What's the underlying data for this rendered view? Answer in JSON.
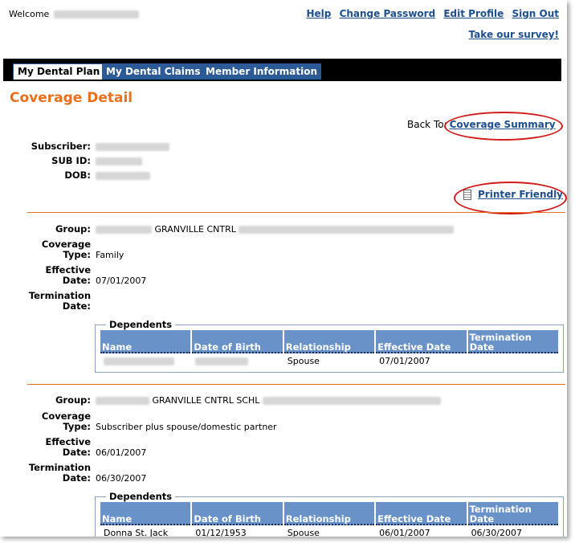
{
  "header": {
    "welcome_label": "Welcome",
    "links": [
      "Help",
      "Change Password",
      "Edit Profile",
      "Sign Out"
    ],
    "survey_link": "Take our survey!"
  },
  "tabs": [
    "My Dental Plan",
    "My Dental Claims",
    "Member Information"
  ],
  "page_title": "Coverage Detail",
  "back_to": {
    "label": "Back To:",
    "link": "Coverage Summary"
  },
  "subscriber": {
    "subscriber_label": "Subscriber:",
    "sub_id_label": "SUB ID:",
    "dob_label": "DOB:"
  },
  "printer_friendly": "Printer Friendly",
  "groups": [
    {
      "group_label": "Group:",
      "group_text": "GRANVILLE CNTRL",
      "coverage_type_label_1": "Coverage",
      "coverage_type_label_2": "Type:",
      "coverage_type": "Family",
      "effective_label_1": "Effective",
      "effective_label_2": "Date:",
      "effective_date": "07/01/2007",
      "termination_label_1": "Termination",
      "termination_label_2": "Date:",
      "termination_date": "",
      "dependents_legend": "Dependents",
      "columns": [
        "Name",
        "Date of Birth",
        "Relationship",
        "Effective Date",
        "Termination Date"
      ],
      "rows": [
        {
          "relationship": "Spouse",
          "effective": "07/01/2007",
          "termination": ""
        }
      ]
    },
    {
      "group_label": "Group:",
      "group_text": "GRANVILLE CNTRL SCHL",
      "coverage_type_label_1": "Coverage",
      "coverage_type_label_2": "Type:",
      "coverage_type": "Subscriber plus spouse/domestic partner",
      "effective_label_1": "Effective",
      "effective_label_2": "Date:",
      "effective_date": "06/01/2007",
      "termination_label_1": "Termination",
      "termination_label_2": "Date:",
      "termination_date": "06/30/2007",
      "dependents_legend": "Dependents",
      "columns": [
        "Name",
        "Date of Birth",
        "Relationship",
        "Effective Date",
        "Termination Date"
      ],
      "rows": [
        {
          "name": "Donna St. Jack",
          "dob": "01/12/1953",
          "relationship": "Spouse",
          "effective": "06/01/2007",
          "termination": "06/30/2007"
        }
      ]
    }
  ],
  "colors": {
    "accent_orange": "#e8701e",
    "link_blue": "#1e4e8e",
    "tab_blue": "#2c5a96",
    "table_header_blue": "#6892c8",
    "annotation_red": "#d21c1c"
  }
}
